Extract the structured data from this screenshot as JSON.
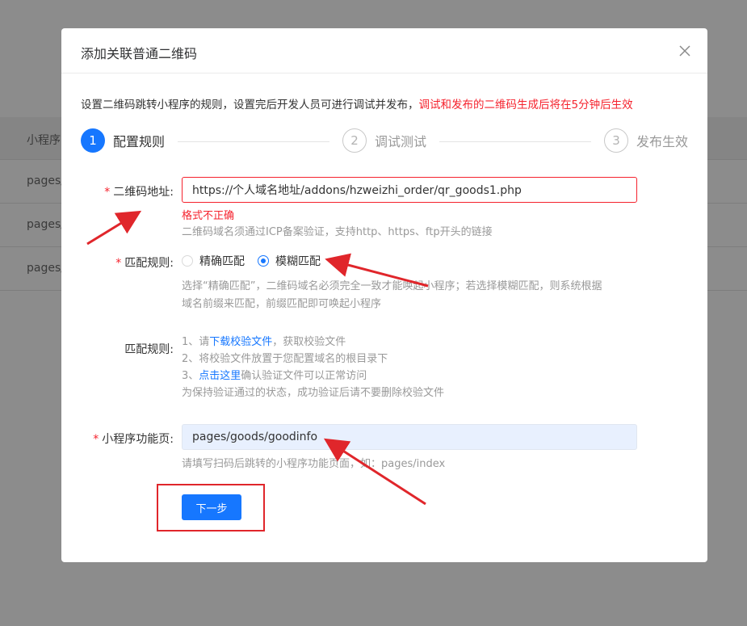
{
  "background": {
    "header_label": "小程序",
    "rows": [
      "pages/",
      "pages/",
      "pages/"
    ]
  },
  "modal": {
    "title": "添加关联普通二维码",
    "close_icon": "close-icon",
    "description": "设置二维码跳转小程序的规则，设置完后开发人员可进行调试并发布，",
    "description_warning": "调试和发布的二维码生成后将在5分钟后生效",
    "steps": [
      {
        "number": "1",
        "label": "配置规则",
        "active": true
      },
      {
        "number": "2",
        "label": "调试测试",
        "active": false
      },
      {
        "number": "3",
        "label": "发布生效",
        "active": false
      }
    ],
    "form": {
      "qr_address": {
        "required_mark": "*",
        "label": "二维码地址:",
        "value": "https://个人域名地址/addons/hzweizhi_order/qr_goods1.php",
        "error": "格式不正确",
        "hint": "二维码域名须通过ICP备案验证，支持http、https、ftp开头的链接"
      },
      "match_rule": {
        "required_mark": "*",
        "label": "匹配规则:",
        "options": [
          {
            "label": "精确匹配",
            "checked": false
          },
          {
            "label": "模糊匹配",
            "checked": true
          }
        ],
        "hint_line1": "选择“精确匹配”，二维码域名必须完全一致才能唤起小程序；若选择模糊匹配，则系统根据",
        "hint_line2": "域名前缀来匹配，前缀匹配即可唤起小程序"
      },
      "verify_rule": {
        "label": "匹配规则:",
        "line1_prefix": "1、请",
        "line1_link": "下载校验文件",
        "line1_suffix": "，获取校验文件",
        "line2": "2、将校验文件放置于您配置域名的根目录下",
        "line3_prefix": "3、",
        "line3_link": "点击这里",
        "line3_suffix": "确认验证文件可以正常访问",
        "line4": "为保持验证通过的状态，成功验证后请不要删除校验文件"
      },
      "mini_page": {
        "required_mark": "*",
        "label": "小程序功能页:",
        "value": "pages/goods/goodinfo",
        "hint": "请填写扫码后跳转的小程序功能页面，如：pages/index"
      }
    },
    "next_button": "下一步"
  },
  "colors": {
    "primary": "#1677ff",
    "error": "#f5222d",
    "annotation": "#e0262b",
    "overlay": "#8c8c8c"
  }
}
